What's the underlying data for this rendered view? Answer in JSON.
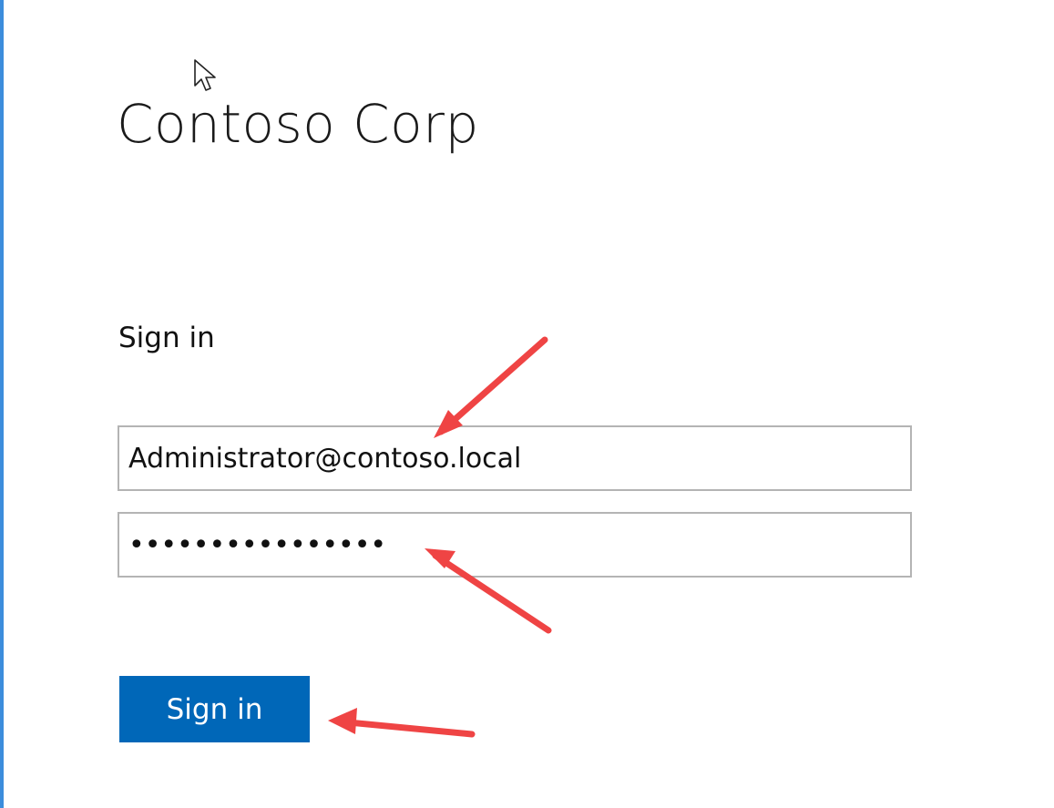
{
  "branding": {
    "company_name": "Contoso Corp"
  },
  "form": {
    "heading": "Sign in",
    "username_value": "Administrator@contoso.local",
    "password_value": "••••••••••••••••",
    "submit_label": "Sign in"
  },
  "annotations": {
    "arrow_color": "#ef4444",
    "arrow_count": 3
  },
  "colors": {
    "button_background": "#0067b8",
    "button_text": "#ffffff",
    "field_border": "#b4b4b4",
    "window_edge": "#3c8ddc"
  },
  "icons": {
    "cursor": "mouse-pointer-icon"
  }
}
